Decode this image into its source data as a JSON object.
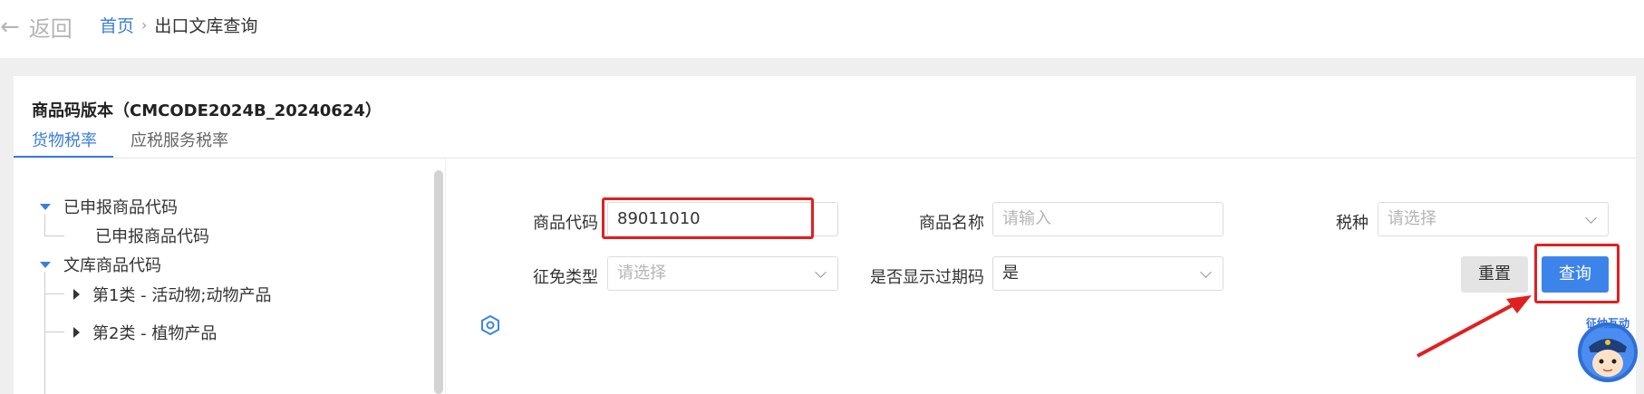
{
  "nav": {
    "back_label": "返回",
    "home": "首页",
    "separator": "›",
    "current": "出口文库查询"
  },
  "version_title": "商品码版本（CMCODE2024B_20240624）",
  "tabs": [
    {
      "label": "货物税率",
      "active": true
    },
    {
      "label": "应税服务税率",
      "active": false
    }
  ],
  "tree": {
    "nodes": [
      {
        "label": "已申报商品代码",
        "expanded": true
      },
      {
        "label": "已申报商品代码",
        "expanded": false
      },
      {
        "label": "文库商品代码",
        "expanded": true
      },
      {
        "label": "第1类 - 活动物;动物产品",
        "expanded": false
      },
      {
        "label": "第2类 - 植物产品",
        "expanded": false
      }
    ]
  },
  "form": {
    "product_code": {
      "label": "商品代码",
      "value": "89011010"
    },
    "product_name": {
      "label": "商品名称",
      "placeholder": "请输入"
    },
    "tax_type": {
      "label": "税种",
      "placeholder": "请选择"
    },
    "exemption_type": {
      "label": "征免类型",
      "placeholder": "请选择"
    },
    "show_expired": {
      "label": "是否显示过期码",
      "value": "是"
    }
  },
  "buttons": {
    "reset": "重置",
    "query": "查询"
  },
  "watermark": "征纳互动",
  "colors": {
    "accent": "#3d84ea",
    "annotation": "#e02020"
  }
}
